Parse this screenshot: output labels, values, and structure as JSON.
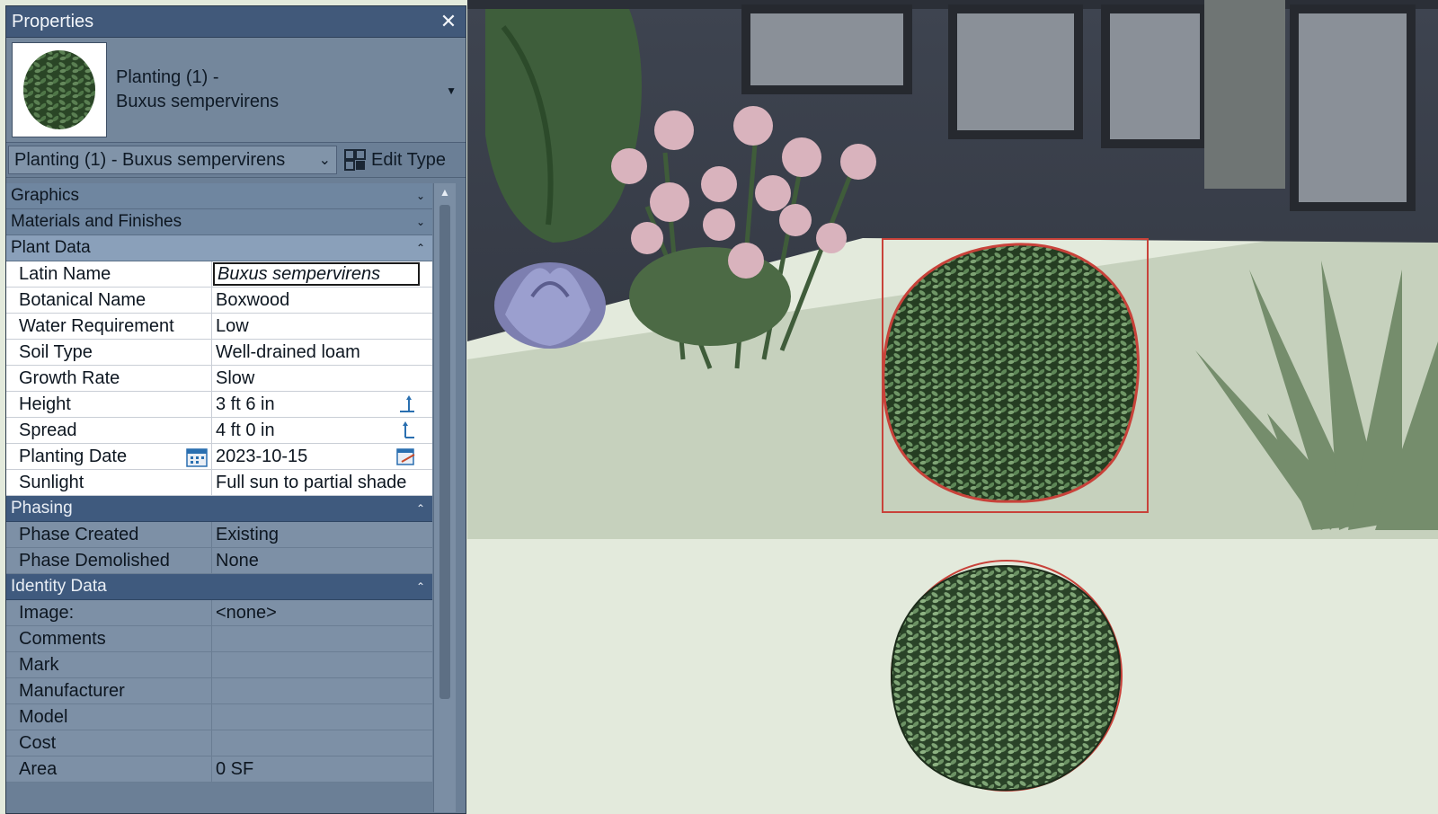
{
  "panel": {
    "title": "Properties",
    "close_label": "✕",
    "type_name": [
      "Planting (1) -",
      "Buxus sempervirens"
    ],
    "type_selector": "Planting (1) - Buxus sempervirens",
    "edit_type_label": "Edit Type"
  },
  "sections": {
    "graphics": "Graphics",
    "materials": "Materials and Finishes",
    "plant_data": "Plant Data",
    "phasing": "Phasing",
    "identity": "Identity Data"
  },
  "plant_data": [
    {
      "name": "Latin Name",
      "value": "Buxus sempervirens"
    },
    {
      "name": "Botanical Name",
      "value": "Boxwood"
    },
    {
      "name": "Water Requirement",
      "value": "Low"
    },
    {
      "name": "Soil Type",
      "value": "Well-drained loam"
    },
    {
      "name": "Growth Rate",
      "value": "Slow"
    },
    {
      "name": "Height",
      "value": "3 ft 6 in"
    },
    {
      "name": "Spread",
      "value": "4 ft 0 in"
    },
    {
      "name": "Planting Date",
      "value": "2023-10-15"
    },
    {
      "name": "Sunlight",
      "value": "Full sun to partial shade"
    }
  ],
  "phasing": [
    {
      "name": "Phase Created",
      "value": "Existing"
    },
    {
      "name": "Phase Demolished",
      "value": "None"
    }
  ],
  "identity": [
    {
      "name": "Image:",
      "value": "<none>"
    },
    {
      "name": "Comments",
      "value": ""
    },
    {
      "name": "Mark",
      "value": ""
    },
    {
      "name": "Manufacturer",
      "value": ""
    },
    {
      "name": "Model",
      "value": ""
    },
    {
      "name": "Cost",
      "value": ""
    },
    {
      "name": "Area",
      "value": "0 SF"
    }
  ],
  "colors": {
    "panel_bg": "#6b7f96",
    "titlebar": "#41597a",
    "section_dark": "#3f5a7e",
    "selection_red": "#c8423a",
    "shrub_green": "#3d5e35"
  },
  "icons": {
    "close": "close-icon",
    "dropdown": "chevron-down-icon",
    "edit_type": "edit-type-icon",
    "collapse": "chevron-up-icon",
    "height_grip": "dimension-grip-icon",
    "calendar": "calendar-icon"
  }
}
